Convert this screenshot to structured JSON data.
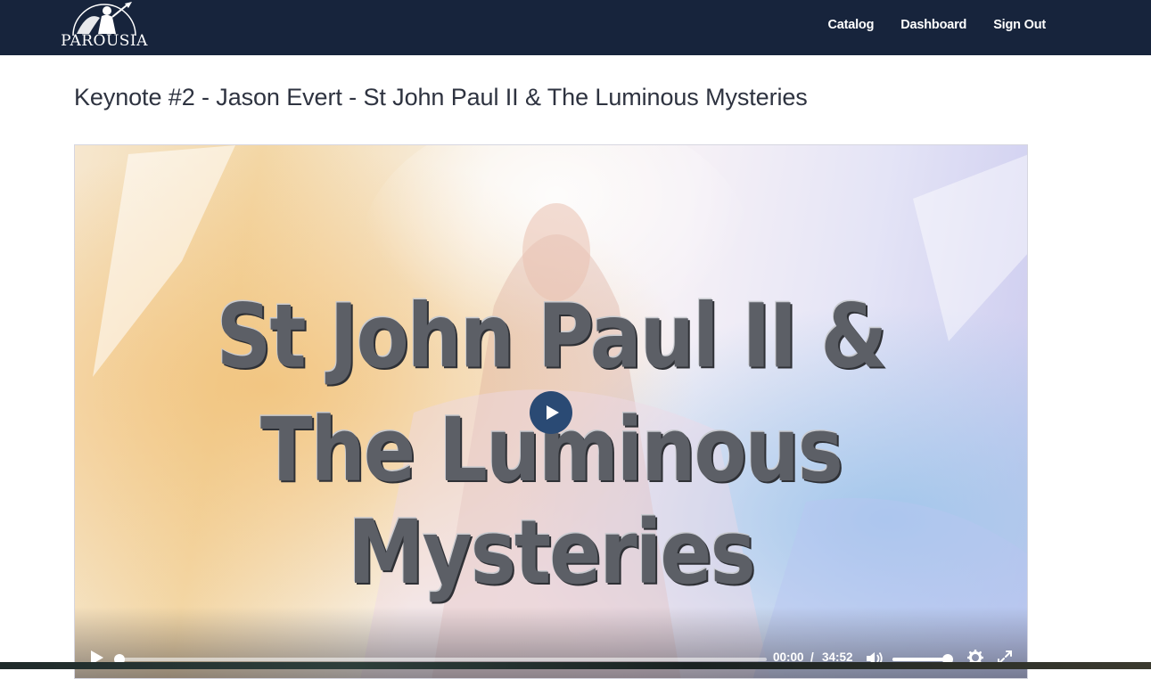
{
  "brand": {
    "logo_text": "PAROUSIA"
  },
  "nav": {
    "links": [
      {
        "label": "Catalog"
      },
      {
        "label": "Dashboard"
      },
      {
        "label": "Sign Out"
      }
    ]
  },
  "page": {
    "title": "Keynote #2 - Jason Evert - St John Paul II & The Luminous Mysteries"
  },
  "video": {
    "frame_text_line1": "St John Paul II &",
    "frame_text_line2": "The Luminous Mysteries",
    "current_time": "00:00",
    "time_separator": "/",
    "duration": "34:52",
    "progress": 0.0,
    "volume": 1.0
  },
  "colors": {
    "nav_background": "#17243c",
    "play_button": "#2a4a74"
  },
  "icons": [
    "angel-logo-icon",
    "play-icon",
    "volume-icon",
    "gear-icon",
    "fullscreen-icon"
  ]
}
